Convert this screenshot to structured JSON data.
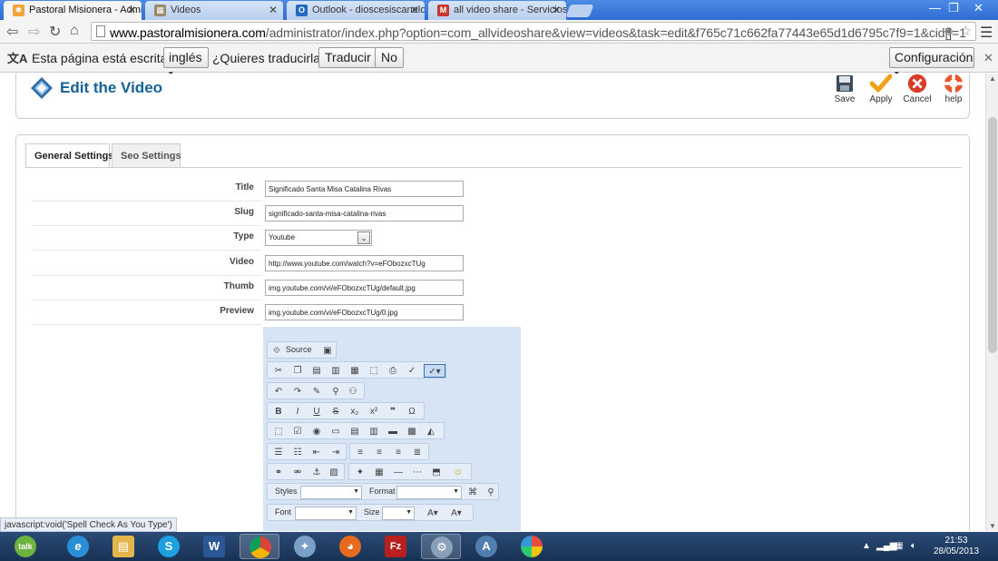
{
  "browser": {
    "tabs": [
      {
        "title": "Pastoral Misionera - Admi",
        "active": true,
        "icon": "joomla-icon",
        "color": "#f2a33a"
      },
      {
        "title": "Videos",
        "active": false,
        "icon": "page-icon",
        "color": "#888888"
      },
      {
        "title": "Outlook - dioscesiscanelo",
        "active": false,
        "icon": "outlook-icon",
        "color": "#1f6bc2"
      },
      {
        "title": "all video share - Servicios",
        "active": false,
        "icon": "gmail-icon",
        "color": "#c8372d"
      }
    ],
    "url_domain": "www.pastoralmisionera.com",
    "url_path": "/administrator/index.php?option=com_allvideoshare&view=videos&task=edit&f765c71c662fa77443e65d1d6795c7f9=1&cid[]=1",
    "window_controls": [
      "—",
      "❐",
      "✕"
    ]
  },
  "translate_bar": {
    "message": "Esta página está escrita en",
    "language": "inglés",
    "question": "¿Quieres traducirla?",
    "translate_button": "Traducir",
    "no_button": "No",
    "settings_button": "Configuración"
  },
  "header": {
    "title": "Edit the Video",
    "actions": [
      {
        "label": "Save",
        "icon": "save-icon"
      },
      {
        "label": "Apply",
        "icon": "apply-icon"
      },
      {
        "label": "Cancel",
        "icon": "cancel-icon"
      },
      {
        "label": "help",
        "icon": "help-icon"
      }
    ]
  },
  "tabs": [
    {
      "label": "General Settings",
      "active": true
    },
    {
      "label": "Seo Settings",
      "active": false
    }
  ],
  "form": {
    "title": {
      "label": "Title",
      "value": "Significado Santa Misa Catalina Rivas"
    },
    "slug": {
      "label": "Slug",
      "value": "significado-santa-misa-catalina-rivas"
    },
    "type": {
      "label": "Type",
      "value": "Youtube"
    },
    "video": {
      "label": "Video",
      "value": "http://www.youtube.com/watch?v=eFObozxcTUg"
    },
    "thumb": {
      "label": "Thumb",
      "value": "img.youtube.com/vi/eFObozxcTUg/default.jpg"
    },
    "preview": {
      "label": "Preview",
      "value": "img.youtube.com/vi/eFObozxcTUg/0.jpg"
    }
  },
  "editor": {
    "source_label": "Source",
    "styles_label": "Styles",
    "format_label": "Format",
    "font_label": "Font",
    "size_label": "Size"
  },
  "status_text": "javascript:void('Spell Check As You Type')",
  "taskbar": {
    "apps": [
      {
        "name": "talk",
        "glyph": "talk",
        "color": "#6db33f"
      },
      {
        "name": "internet-explorer",
        "glyph": "e",
        "color": "#2a8fd6"
      },
      {
        "name": "file-explorer",
        "glyph": "▤",
        "color": "#e3b54a"
      },
      {
        "name": "skype",
        "glyph": "S",
        "color": "#1ea0e0"
      },
      {
        "name": "word",
        "glyph": "W",
        "color": "#2b5797"
      },
      {
        "name": "chrome",
        "glyph": "◉",
        "color": "#3d9c40"
      },
      {
        "name": "app-generic",
        "glyph": "✦",
        "color": "#7aa0c8"
      },
      {
        "name": "firefox",
        "glyph": "◕",
        "color": "#e66b1e"
      },
      {
        "name": "filezilla",
        "glyph": "Fz",
        "color": "#b8201f"
      },
      {
        "name": "app-gear",
        "glyph": "⚙",
        "color": "#8a9fb8"
      },
      {
        "name": "app-a",
        "glyph": "A",
        "color": "#4f7fb0"
      },
      {
        "name": "picasa",
        "glyph": "✿",
        "color": "#9b59b6"
      }
    ],
    "time": "21:53",
    "date": "28/05/2013"
  }
}
